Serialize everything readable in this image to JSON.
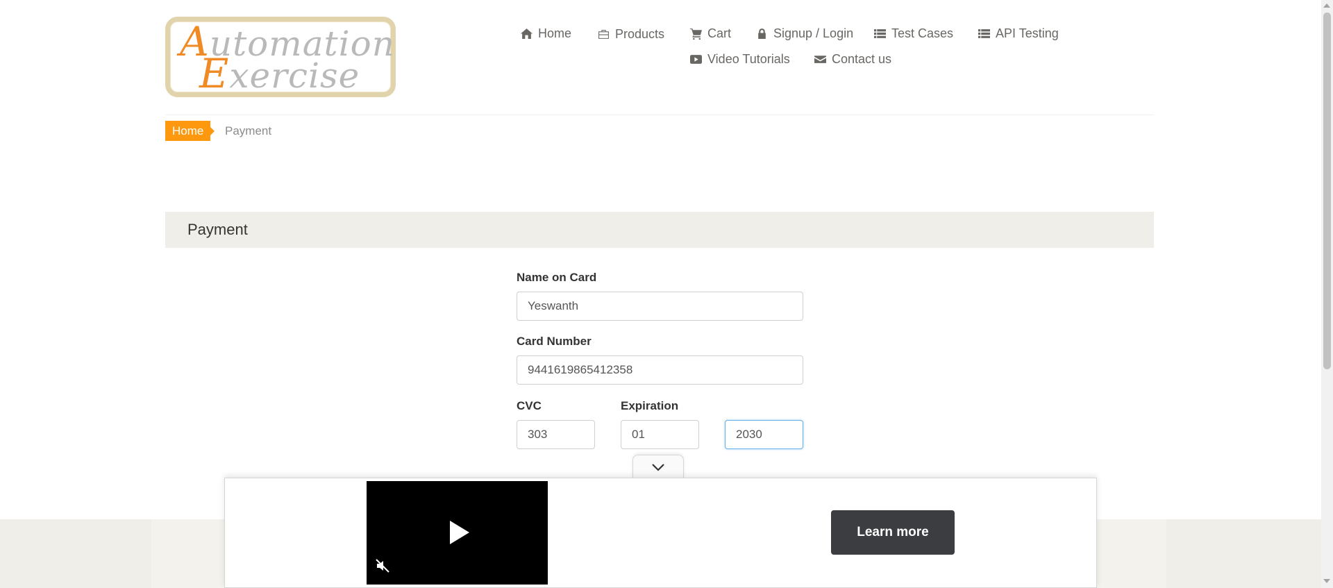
{
  "logo": {
    "line1_cap": "A",
    "line1_rest": "utomation",
    "line2_cap": "E",
    "line2_rest": "xercise"
  },
  "nav": {
    "home": "Home",
    "products": "Products",
    "cart": "Cart",
    "signup_login": "Signup / Login",
    "test_cases": "Test Cases",
    "api_testing": "API Testing",
    "video_tutorials": "Video Tutorials",
    "contact_us": "Contact us"
  },
  "breadcrumb": {
    "home": "Home",
    "current": "Payment"
  },
  "payment": {
    "heading": "Payment",
    "name_label": "Name on Card",
    "name_value": "Yeswanth",
    "card_label": "Card Number",
    "card_value": "9441619865412358",
    "cvc_label": "CVC",
    "cvc_value": "303",
    "expiration_label": "Expiration",
    "exp_month_value": "01",
    "exp_year_value": "2030"
  },
  "ad": {
    "learn_more": "Learn more"
  },
  "colors": {
    "accent": "#fe980f",
    "heading_bg": "#efeee8",
    "nav_text": "#696763"
  },
  "icons": [
    "home-icon",
    "briefcase-icon",
    "cart-icon",
    "lock-icon",
    "list-icon",
    "list-icon",
    "youtube-play-icon",
    "envelope-icon",
    "play-icon",
    "mute-icon",
    "chevron-down-icon"
  ]
}
